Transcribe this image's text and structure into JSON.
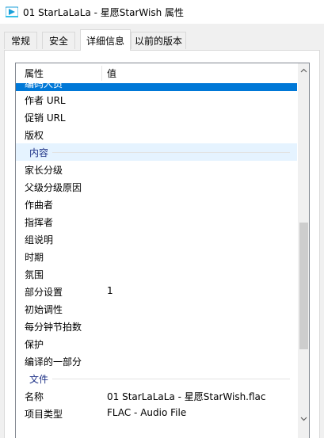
{
  "window": {
    "title": "01 StarLaLaLa - 星愿StarWish 属性",
    "icon": "media-file-icon"
  },
  "tabs": [
    {
      "label": "常规"
    },
    {
      "label": "安全"
    },
    {
      "label": "详细信息"
    },
    {
      "label": "以前的版本"
    }
  ],
  "active_tab": "详细信息",
  "list": {
    "headers": {
      "property": "属性",
      "value": "值"
    },
    "partial_row_label": "编码人员",
    "rows_top": [
      {
        "name": "作者 URL",
        "value": ""
      },
      {
        "name": "促销 URL",
        "value": ""
      },
      {
        "name": "版权",
        "value": ""
      }
    ],
    "group_content": "内容",
    "rows_content": [
      {
        "name": "家长分级",
        "value": ""
      },
      {
        "name": "父级分级原因",
        "value": ""
      },
      {
        "name": "作曲者",
        "value": ""
      },
      {
        "name": "指挥者",
        "value": ""
      },
      {
        "name": "组说明",
        "value": ""
      },
      {
        "name": "时期",
        "value": ""
      },
      {
        "name": "氛围",
        "value": ""
      },
      {
        "name": "部分设置",
        "value": "1"
      },
      {
        "name": "初始调性",
        "value": ""
      },
      {
        "name": "每分钟节拍数",
        "value": ""
      },
      {
        "name": "保护",
        "value": ""
      },
      {
        "name": "编译的一部分",
        "value": ""
      }
    ],
    "group_file": "文件",
    "rows_file": [
      {
        "name": "名称",
        "value": "01 StarLaLaLa - 星愿StarWish.flac"
      },
      {
        "name": "项目类型",
        "value": "FLAC - Audio File"
      }
    ]
  },
  "colors": {
    "selection": "#0078d7",
    "group_text": "#1e3287",
    "group_hover": "#e5f3ff"
  }
}
